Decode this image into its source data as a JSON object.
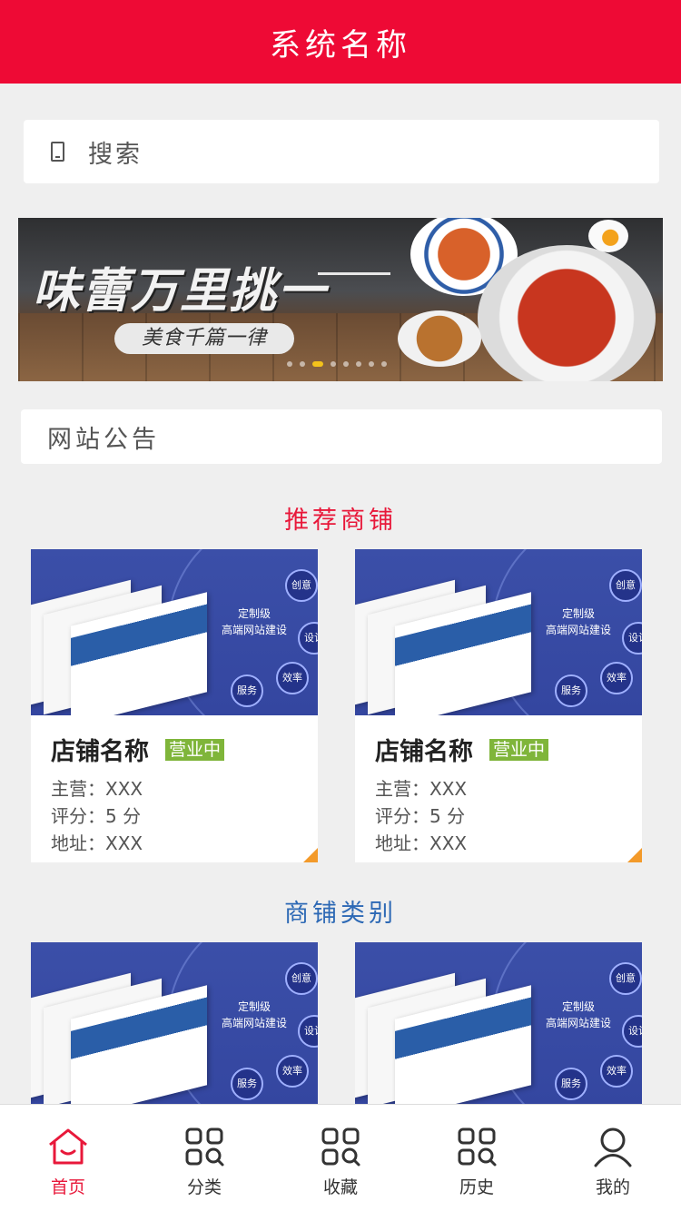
{
  "header": {
    "title": "系统名称"
  },
  "search": {
    "label": "搜索"
  },
  "banner": {
    "slogan": "味蕾万里挑一",
    "subtitle": "美食千篇一律",
    "slide_count": 8,
    "active_slide": 3
  },
  "notice": {
    "label": "网站公告"
  },
  "recommended": {
    "title": "推荐商铺",
    "shops": [
      {
        "name": "店铺名称",
        "status": "营业中",
        "main": "主营：XXX",
        "rating": "评分：5 分",
        "address": "地址：XXX",
        "image_texts": {
          "line1": "定制级",
          "line2": "高端网站建设",
          "c1": "创意",
          "c2": "设计",
          "c3": "效率",
          "c4": "服务"
        }
      },
      {
        "name": "店铺名称",
        "status": "营业中",
        "main": "主营：XXX",
        "rating": "评分：5 分",
        "address": "地址：XXX",
        "image_texts": {
          "line1": "定制级",
          "line2": "高端网站建设",
          "c1": "创意",
          "c2": "设计",
          "c3": "效率",
          "c4": "服务"
        }
      }
    ]
  },
  "categories": {
    "title": "商铺类别",
    "items": [
      {
        "image_texts": {
          "line1": "定制级",
          "line2": "高端网站建设",
          "c1": "创意",
          "c2": "设计",
          "c3": "效率",
          "c4": "服务"
        }
      },
      {
        "image_texts": {
          "line1": "定制级",
          "line2": "高端网站建设",
          "c1": "创意",
          "c2": "设计",
          "c3": "效率",
          "c4": "服务"
        }
      }
    ]
  },
  "tabbar": {
    "tabs": [
      {
        "label": "首页",
        "icon": "home-icon",
        "active": true
      },
      {
        "label": "分类",
        "icon": "grid-icon",
        "active": false
      },
      {
        "label": "收藏",
        "icon": "grid-icon",
        "active": false
      },
      {
        "label": "历史",
        "icon": "grid-icon",
        "active": false
      },
      {
        "label": "我的",
        "icon": "user-icon",
        "active": false
      }
    ]
  },
  "colors": {
    "brand": "#ee0a35",
    "section_red": "#e8183a",
    "section_blue": "#2d69b5",
    "badge_green": "#7fb53a"
  }
}
